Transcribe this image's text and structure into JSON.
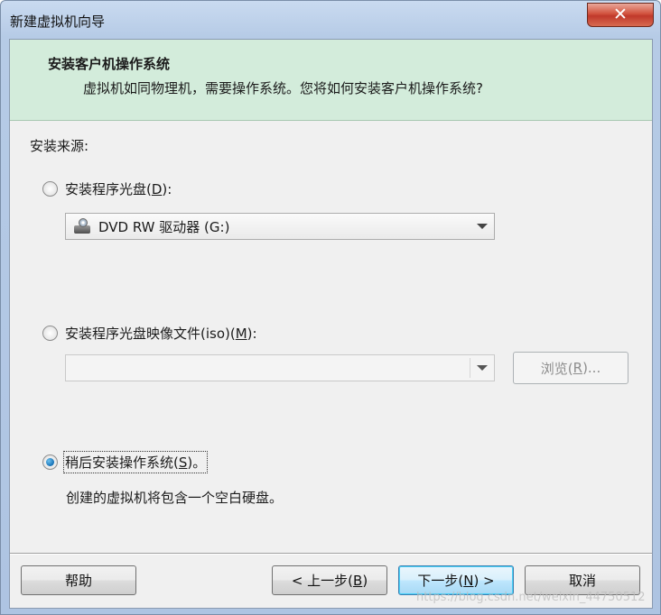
{
  "window": {
    "title": "新建虚拟机向导",
    "close_label": "✕"
  },
  "header": {
    "title": "安装客户机操作系统",
    "subtitle": "虚拟机如同物理机，需要操作系统。您将如何安装客户机操作系统?"
  },
  "source": {
    "label": "安装来源:",
    "options": [
      {
        "label_prefix": "安装程序光盘(",
        "mnemonic": "D",
        "label_suffix": "):",
        "selected": false
      },
      {
        "label_prefix": "安装程序光盘映像文件(iso)(",
        "mnemonic": "M",
        "label_suffix": "):",
        "selected": false
      },
      {
        "label_prefix": "稍后安装操作系统(",
        "mnemonic": "S",
        "label_suffix": ")。",
        "selected": true
      }
    ],
    "drive_select": {
      "value": "DVD RW 驱动器 (G:)",
      "icon": "dvd-drive-icon"
    },
    "iso_select": {
      "value": ""
    },
    "browse": {
      "label_prefix": "浏览(",
      "mnemonic": "R",
      "label_suffix": ")..."
    },
    "later_description": "创建的虚拟机将包含一个空白硬盘。"
  },
  "footer": {
    "help": "帮助",
    "back": {
      "label_prefix": "< 上一步(",
      "mnemonic": "B",
      "label_suffix": ")"
    },
    "next": {
      "label_prefix": "下一步(",
      "mnemonic": "N",
      "label_suffix": ") >"
    },
    "cancel": "取消",
    "watermark": "https://blog.csdn.net/weixin_44750512"
  },
  "colors": {
    "header_band": "#d3ecdb",
    "dialog_bg": "#f0f0f0",
    "accent": "#136fb5"
  }
}
